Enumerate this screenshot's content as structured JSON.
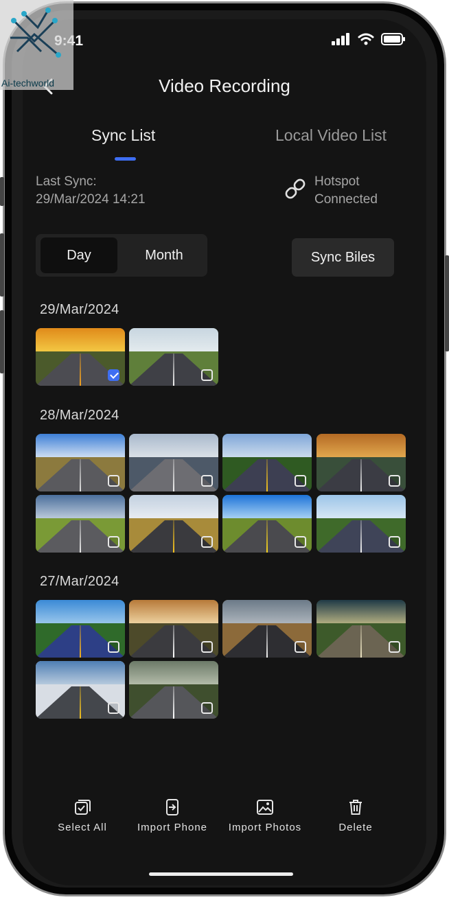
{
  "status_bar": {
    "time": "9:41"
  },
  "header": {
    "title": "Video Recording"
  },
  "tabs": [
    {
      "label": "Sync List",
      "active": true
    },
    {
      "label": "Local Video List",
      "active": false
    }
  ],
  "sync_info": {
    "last_sync_label": "Last Sync:",
    "last_sync_value": "29/Mar/2024 14:21",
    "hotspot_line1": "Hotspot",
    "hotspot_line2": "Connected"
  },
  "segment": {
    "options": [
      "Day",
      "Month"
    ],
    "selected": "Day"
  },
  "sync_button": {
    "label": "Sync Biles"
  },
  "groups": [
    {
      "date": "29/Mar/2024",
      "videos": [
        {
          "scene": "sunset-road",
          "checked": true
        },
        {
          "scene": "green-hills-road",
          "checked": false
        }
      ]
    },
    {
      "date": "28/Mar/2024",
      "videos": [
        {
          "scene": "clouds-road",
          "checked": false
        },
        {
          "scene": "mountain-road",
          "checked": false
        },
        {
          "scene": "forest-highway",
          "checked": false
        },
        {
          "scene": "dusk-highway",
          "checked": false
        },
        {
          "scene": "field-road",
          "checked": false
        },
        {
          "scene": "golden-road",
          "checked": false
        },
        {
          "scene": "blue-sky-road",
          "checked": false
        },
        {
          "scene": "tree-lined-highway",
          "checked": false
        }
      ]
    },
    {
      "date": "27/Mar/2024",
      "videos": [
        {
          "scene": "colored-lane-road",
          "checked": false
        },
        {
          "scene": "sunburst-road",
          "checked": false
        },
        {
          "scene": "desert-road",
          "checked": false
        },
        {
          "scene": "stormy-road",
          "checked": false
        },
        {
          "scene": "snowy-mountain-road",
          "checked": false
        },
        {
          "scene": "crosswalk-road",
          "checked": false
        }
      ]
    }
  ],
  "bottom_actions": [
    {
      "label": "Select All",
      "icon": "select-all-icon"
    },
    {
      "label": "Import Phone",
      "icon": "import-phone-icon"
    },
    {
      "label": "Import Photos",
      "icon": "import-photos-icon"
    },
    {
      "label": "Delete",
      "icon": "trash-icon"
    }
  ],
  "watermark": {
    "text": "Ai-techworld"
  },
  "colors": {
    "accent": "#3e6ef2",
    "background": "#141414"
  }
}
